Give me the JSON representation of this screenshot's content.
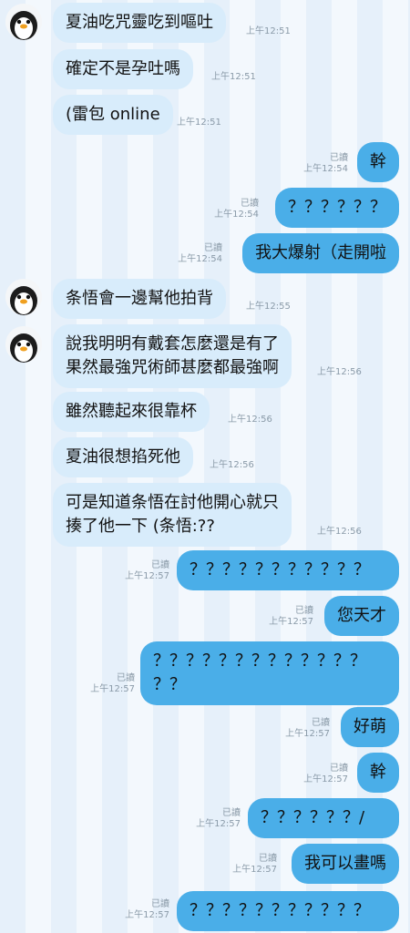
{
  "messages": [
    {
      "side": "in",
      "avatar": true,
      "text": "夏油吃咒靈吃到嘔吐",
      "time": "上午12:51"
    },
    {
      "side": "in",
      "avatar": false,
      "text": "確定不是孕吐嗎",
      "time": "上午12:51"
    },
    {
      "side": "in",
      "avatar": false,
      "text": "(雷包 online",
      "time": "上午12:51"
    },
    {
      "side": "out",
      "text": "幹",
      "read": "已讀",
      "time": "上午12:54"
    },
    {
      "side": "out",
      "text": "？？？？？？",
      "read": "已讀",
      "time": "上午12:54"
    },
    {
      "side": "out",
      "text": "我大爆射（走開啦",
      "read": "已讀",
      "time": "上午12:54"
    },
    {
      "side": "in",
      "avatar": true,
      "text": "条悟會一邊幫他拍背",
      "time": "上午12:55"
    },
    {
      "side": "in",
      "avatar": true,
      "text": "說我明明有戴套怎麼還是有了\n果然最強咒術師甚麼都最強啊",
      "time": "上午12:56"
    },
    {
      "side": "in",
      "avatar": false,
      "text": "雖然聽起來很靠杯",
      "time": "上午12:56"
    },
    {
      "side": "in",
      "avatar": false,
      "text": "夏油很想掐死他",
      "time": "上午12:56"
    },
    {
      "side": "in",
      "avatar": false,
      "text": "可是知道条悟在討他開心就只\n揍了他一下 (条悟:??",
      "time": "上午12:56"
    },
    {
      "side": "out",
      "text": "？？？？？？？？？？？",
      "read": "已讀",
      "time": "上午12:57"
    },
    {
      "side": "out",
      "text": "您天才",
      "read": "已讀",
      "time": "上午12:57"
    },
    {
      "side": "out",
      "text": "？？？？？？？？？？？？？\n？？",
      "read": "已讀",
      "time": "上午12:57"
    },
    {
      "side": "out",
      "text": "好萌",
      "read": "已讀",
      "time": "上午12:57"
    },
    {
      "side": "out",
      "text": "幹",
      "read": "已讀",
      "time": "上午12:57"
    },
    {
      "side": "out",
      "text": "？？？？？？/",
      "read": "已讀",
      "time": "上午12:57"
    },
    {
      "side": "out",
      "text": "我可以畫嗎",
      "read": "已讀",
      "time": "上午12:57"
    },
    {
      "side": "out",
      "text": "？？？？？？？？？？？",
      "read": "已讀",
      "time": "上午12:57"
    }
  ],
  "colors": {
    "incoming_bubble": "#d8ecfb",
    "outgoing_bubble": "#4aaee8",
    "meta_text": "#8a9aa8"
  },
  "icons": {
    "avatar": "penguin-avatar-icon"
  }
}
